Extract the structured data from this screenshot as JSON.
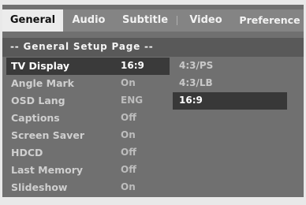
{
  "tabs": [
    {
      "label": "General",
      "active": true
    },
    {
      "label": "Audio",
      "active": false
    },
    {
      "label": "Subtitle",
      "active": false
    },
    {
      "label": "Video",
      "active": false
    },
    {
      "label": "Preference",
      "active": false
    }
  ],
  "page_title": "-- General Setup Page --",
  "menu": [
    {
      "label": "TV Display",
      "value": "16:9",
      "selected": true
    },
    {
      "label": "Angle Mark",
      "value": "On",
      "selected": false
    },
    {
      "label": "OSD Lang",
      "value": "ENG",
      "selected": false
    },
    {
      "label": "Captions",
      "value": "Off",
      "selected": false
    },
    {
      "label": "Screen Saver",
      "value": "On",
      "selected": false
    },
    {
      "label": "HDCD",
      "value": "Off",
      "selected": false
    },
    {
      "label": "Last Memory",
      "value": "Off",
      "selected": false
    },
    {
      "label": "Slideshow",
      "value": "On",
      "selected": false
    }
  ],
  "options": [
    {
      "label": "4:3/PS",
      "selected": false
    },
    {
      "label": "4:3/LB",
      "selected": false
    },
    {
      "label": "16:9",
      "selected": true
    }
  ],
  "colors": {
    "panel": "#707070",
    "tab_bar": "#848484",
    "active_tab": "#ececec",
    "header_bar": "#595959",
    "highlight": "#3a3a3a"
  }
}
